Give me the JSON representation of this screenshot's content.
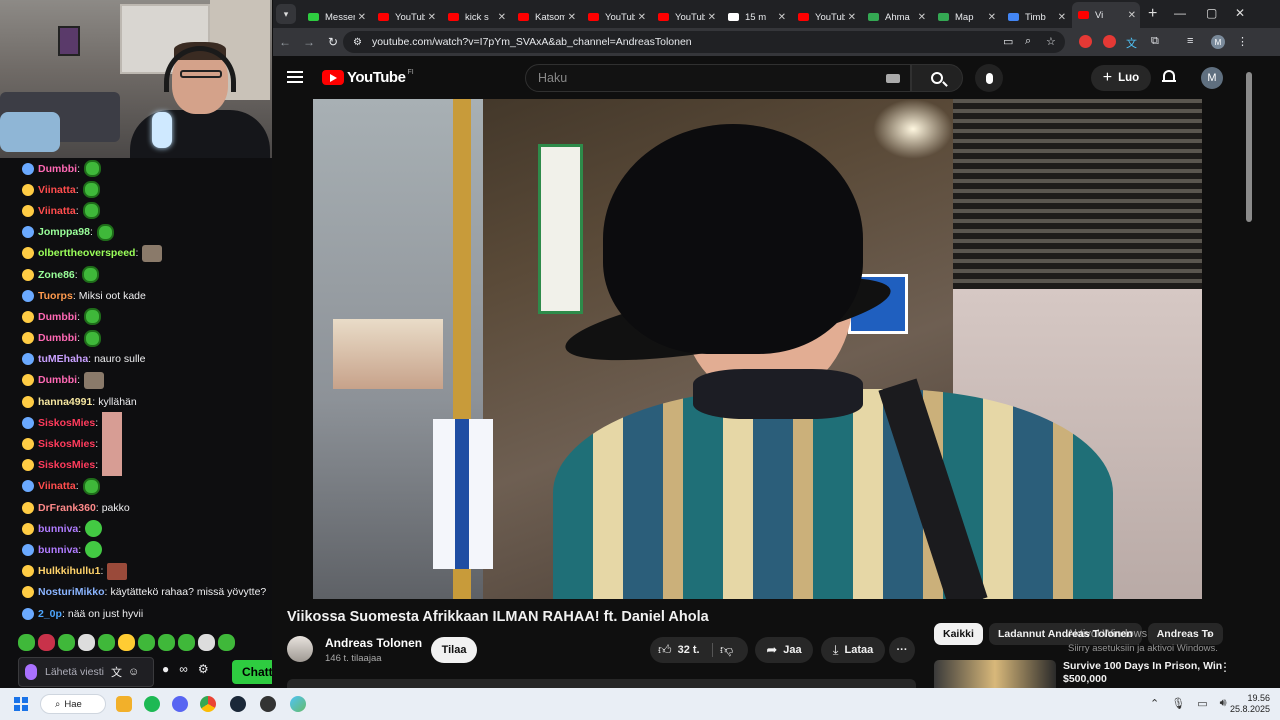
{
  "chat": {
    "lines": [
      {
        "user": "Dumbbi",
        "msg": "",
        "color": "#ff69b4",
        "emote": "pepe"
      },
      {
        "user": "Viinatta",
        "msg": "",
        "color": "#ff4d4d",
        "emote": "pepe"
      },
      {
        "user": "Viinatta",
        "msg": "",
        "color": "#ff4d4d",
        "emote": "pepe"
      },
      {
        "user": "Jomppa98",
        "msg": "",
        "color": "#9aff9a",
        "emote": "pepe"
      },
      {
        "user": "olberttheoverspeed",
        "msg": "",
        "color": "#9aff5a",
        "emote": "dog"
      },
      {
        "user": "Zone86",
        "msg": "",
        "color": "#9aff9a",
        "emote": "pepe"
      },
      {
        "user": "Tuorps",
        "msg": "Miksi oot kade",
        "color": "#ff9a4d",
        "emote": ""
      },
      {
        "user": "Dumbbi",
        "msg": "",
        "color": "#ff69b4",
        "emote": "pepe"
      },
      {
        "user": "Dumbbi",
        "msg": "",
        "color": "#ff69b4",
        "emote": "pepe"
      },
      {
        "user": "tuMEhaha",
        "msg": "nauro sulle",
        "color": "#c9a0ff",
        "emote": ""
      },
      {
        "user": "Dumbbi",
        "msg": "",
        "color": "#ff69b4",
        "emote": "dog"
      },
      {
        "user": "hanna4991",
        "msg": "kyllähän",
        "color": "#f5e6a0",
        "emote": ""
      },
      {
        "user": "SiskosMies",
        "msg": "",
        "color": "#ff3b5c",
        "emote": "face"
      },
      {
        "user": "SiskosMies",
        "msg": "",
        "color": "#ff3b5c",
        "emote": "face"
      },
      {
        "user": "SiskosMies",
        "msg": "",
        "color": "#ff3b5c",
        "emote": "face"
      },
      {
        "user": "Viinatta",
        "msg": "",
        "color": "#ff4d4d",
        "emote": "pepe"
      },
      {
        "user": "DrFrank360",
        "msg": "pakko",
        "color": "#ff8a8a",
        "emote": ""
      },
      {
        "user": "bunniva",
        "msg": "",
        "color": "#b07cff",
        "emote": "blob"
      },
      {
        "user": "bunniva",
        "msg": "",
        "color": "#b07cff",
        "emote": "blob"
      },
      {
        "user": "Hulkkihullu1",
        "msg": "",
        "color": "#ffd36b",
        "emote": "face2"
      },
      {
        "user": "NosturiMikko",
        "msg": "käytättekö rahaa? missä yövytte?",
        "color": "#8ab4ff",
        "emote": ""
      },
      {
        "user": "2_0p",
        "msg": "nää on just hyvii",
        "color": "#4da6ff",
        "emote": ""
      }
    ],
    "input_placeholder": "Lähetä viesti",
    "chat_button": "Chatti",
    "infinity": "∞"
  },
  "browser": {
    "tabs": [
      {
        "title": "Messenger",
        "color": "#2ecc40",
        "active": false
      },
      {
        "title": "YouTube",
        "color": "#ff0000",
        "active": false
      },
      {
        "title": "kick s",
        "color": "#ff0000",
        "active": false
      },
      {
        "title": "Katsomo",
        "color": "#ff0000",
        "active": false
      },
      {
        "title": "YouTube",
        "color": "#ff0000",
        "active": false
      },
      {
        "title": "YouTube",
        "color": "#ff0000",
        "active": false
      },
      {
        "title": "15 m",
        "color": "#ffffff",
        "active": false
      },
      {
        "title": "YouTube",
        "color": "#ff0000",
        "active": false
      },
      {
        "title": "Ahma",
        "color": "#34a853",
        "active": false
      },
      {
        "title": "Map",
        "color": "#34a853",
        "active": false
      },
      {
        "title": "Timb",
        "color": "#4285f4",
        "active": false
      },
      {
        "title": "Vi",
        "color": "#ff0000",
        "active": true
      }
    ],
    "url": "youtube.com/watch?v=I7pYm_SVAxA&ab_channel=AndreasTolonen",
    "profile_initial": "M"
  },
  "youtube": {
    "logo_text": "YouTube",
    "country_code": "FI",
    "search_placeholder": "Haku",
    "create_label": "Luo",
    "avatar_initial": "M",
    "video_title": "Viikossa Suomesta Afrikkaan ILMAN RAHAA! ft. Daniel Ahola",
    "channel_name": "Andreas Tolonen",
    "subscribers": "146 t. tilaajaa",
    "subscribe_label": "Tilaa",
    "likes": "32 t.",
    "share_label": "Jaa",
    "download_label": "Lataa",
    "chips": [
      "Kaikki",
      "Ladannut Andreas Tolonen",
      "Andreas To"
    ],
    "rec_title": "Survive 100 Days In Prison, Win $500,000"
  },
  "windows": {
    "activate_line1": "Aktivoi Windows",
    "activate_line2": "Siirry asetuksiin ja aktivoi Windows.",
    "search_label": "Hae",
    "time": "19.56",
    "date": "25.8.2025"
  }
}
